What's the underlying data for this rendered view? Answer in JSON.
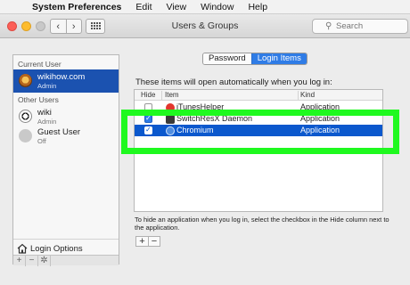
{
  "menubar": {
    "app": "System Preferences",
    "items": [
      "Edit",
      "View",
      "Window",
      "Help"
    ]
  },
  "window": {
    "title": "Users & Groups",
    "search_placeholder": "Search",
    "traffic_lights": [
      "#fc5f57",
      "#fdbc2e",
      "#c8c8c8"
    ]
  },
  "sidebar": {
    "current_user_label": "Current User",
    "other_users_label": "Other Users",
    "users": [
      {
        "name": "wikihow.com",
        "role": "Admin"
      },
      {
        "name": "wiki",
        "role": "Admin"
      },
      {
        "name": "Guest User",
        "role": "Off"
      }
    ],
    "login_options": "Login Options",
    "tools": [
      "+",
      "−",
      "✲"
    ]
  },
  "tabs": [
    "Password",
    "Login Items"
  ],
  "panel": {
    "description": "These items will open automatically when you log in:",
    "columns": {
      "hide": "Hide",
      "item": "Item",
      "kind": "Kind"
    },
    "rows": [
      {
        "name": "iTunesHelper",
        "kind": "Application",
        "hide": false,
        "icon_color": "#e2372e"
      },
      {
        "name": "SwitchResX Daemon",
        "kind": "Application",
        "hide": true,
        "icon_color": "#3a3a3a"
      },
      {
        "name": "Chromium",
        "kind": "Application",
        "hide": true,
        "icon_color": "#4f8de0"
      }
    ],
    "hint": "To hide an application when you log in, select the checkbox in the Hide column next to the application.",
    "add_label": "+",
    "remove_label": "−"
  },
  "colors": {
    "selection": "#0b58cd",
    "tab_active": "#2f7ce6",
    "highlight": "#1ff91f"
  }
}
